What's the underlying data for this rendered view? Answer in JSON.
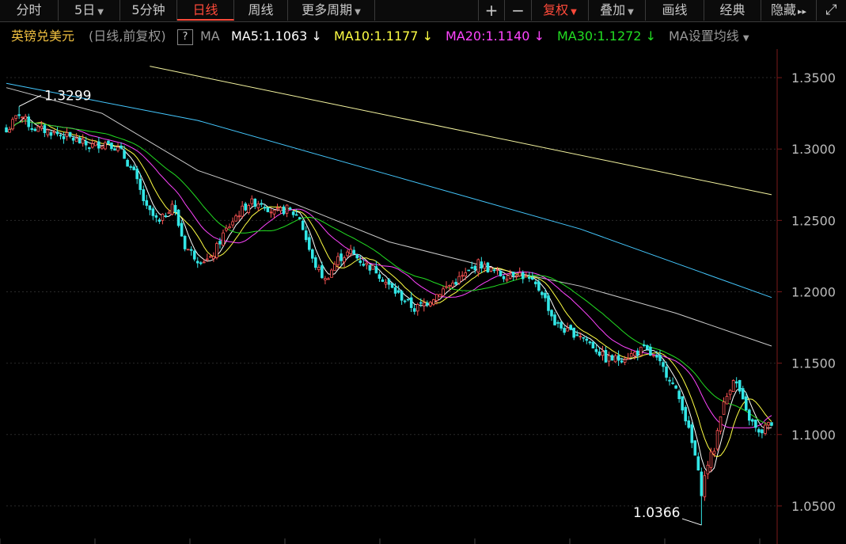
{
  "toolbar": {
    "intraday": "分时",
    "five_day": "5日",
    "five_min": "5分钟",
    "daily": "日线",
    "weekly": "周线",
    "more_periods": "更多周期",
    "plus": "+",
    "minus": "−",
    "adjust": "复权",
    "overlay": "叠加",
    "draw": "画线",
    "classic": "经典",
    "hide": "隐藏",
    "hide_arrows": "▸▸",
    "expand": "⤢"
  },
  "legend": {
    "name": "英镑兑美元",
    "mode": "(日线,前复权)",
    "help": "?",
    "ma_label": "MA",
    "ma5": "MA5:1.1063",
    "ma10": "MA10:1.1177",
    "ma20": "MA20:1.1140",
    "ma30": "MA30:1.1272",
    "arrow": "↓",
    "settings": "MA设置均线",
    "colors": {
      "ma5": "#ffffff",
      "ma10": "#ffff44",
      "ma20": "#ff44ff",
      "ma30": "#22dd22"
    }
  },
  "chart_data": {
    "type": "candlestick",
    "ylim": [
      1.025,
      1.37
    ],
    "yticks": [
      "1.3500",
      "1.3000",
      "1.2500",
      "1.2000",
      "1.1500",
      "1.1000",
      "1.0500"
    ],
    "ytick_values": [
      1.35,
      1.3,
      1.25,
      1.2,
      1.15,
      1.1,
      1.05
    ],
    "grid": true,
    "high_label": "1.3299",
    "low_label": "1.0366",
    "colors": {
      "up": "#ff5555",
      "down": "#33e6e6",
      "long_ma_a": "#f5f5a0",
      "long_ma_b": "#44c8ff",
      "long_ma_c": "#cccccc"
    },
    "close_path": [
      [
        0,
        1.312
      ],
      [
        4,
        1.325
      ],
      [
        8,
        1.315
      ],
      [
        14,
        1.312
      ],
      [
        20,
        1.308
      ],
      [
        26,
        1.302
      ],
      [
        32,
        1.305
      ],
      [
        36,
        1.298
      ],
      [
        40,
        1.283
      ],
      [
        44,
        1.258
      ],
      [
        48,
        1.248
      ],
      [
        52,
        1.262
      ],
      [
        56,
        1.232
      ],
      [
        60,
        1.223
      ],
      [
        64,
        1.222
      ],
      [
        68,
        1.24
      ],
      [
        72,
        1.253
      ],
      [
        76,
        1.262
      ],
      [
        80,
        1.263
      ],
      [
        84,
        1.255
      ],
      [
        88,
        1.258
      ],
      [
        92,
        1.252
      ],
      [
        96,
        1.222
      ],
      [
        100,
        1.208
      ],
      [
        104,
        1.223
      ],
      [
        108,
        1.228
      ],
      [
        112,
        1.22
      ],
      [
        116,
        1.215
      ],
      [
        120,
        1.204
      ],
      [
        124,
        1.196
      ],
      [
        128,
        1.188
      ],
      [
        132,
        1.193
      ],
      [
        136,
        1.2
      ],
      [
        140,
        1.206
      ],
      [
        144,
        1.212
      ],
      [
        148,
        1.22
      ],
      [
        152,
        1.215
      ],
      [
        156,
        1.211
      ],
      [
        160,
        1.214
      ],
      [
        164,
        1.208
      ],
      [
        168,
        1.2
      ],
      [
        172,
        1.178
      ],
      [
        176,
        1.172
      ],
      [
        180,
        1.17
      ],
      [
        184,
        1.162
      ],
      [
        188,
        1.153
      ],
      [
        192,
        1.153
      ],
      [
        196,
        1.156
      ],
      [
        200,
        1.16
      ],
      [
        204,
        1.152
      ],
      [
        208,
        1.14
      ],
      [
        212,
        1.12
      ],
      [
        216,
        1.085
      ],
      [
        218,
        1.06
      ],
      [
        220,
        1.08
      ],
      [
        222,
        1.09
      ],
      [
        224,
        1.115
      ],
      [
        226,
        1.127
      ],
      [
        228,
        1.14
      ],
      [
        230,
        1.13
      ],
      [
        232,
        1.115
      ],
      [
        234,
        1.108
      ],
      [
        236,
        1.1
      ],
      [
        238,
        1.105
      ],
      [
        240,
        1.108
      ]
    ],
    "extremes": [
      [
        4,
        1.3299
      ],
      [
        218,
        1.0366
      ]
    ],
    "ma_yellow_long": [
      [
        45,
        1.358
      ],
      [
        240,
        1.268
      ]
    ],
    "ma_blue_long": [
      [
        0,
        1.346
      ],
      [
        60,
        1.32
      ],
      [
        120,
        1.282
      ],
      [
        180,
        1.244
      ],
      [
        240,
        1.196
      ]
    ],
    "ma_grey_long": [
      [
        0,
        1.343
      ],
      [
        30,
        1.325
      ],
      [
        60,
        1.285
      ],
      [
        90,
        1.262
      ],
      [
        120,
        1.235
      ],
      [
        150,
        1.218
      ],
      [
        180,
        1.204
      ],
      [
        210,
        1.185
      ],
      [
        240,
        1.162
      ]
    ]
  }
}
